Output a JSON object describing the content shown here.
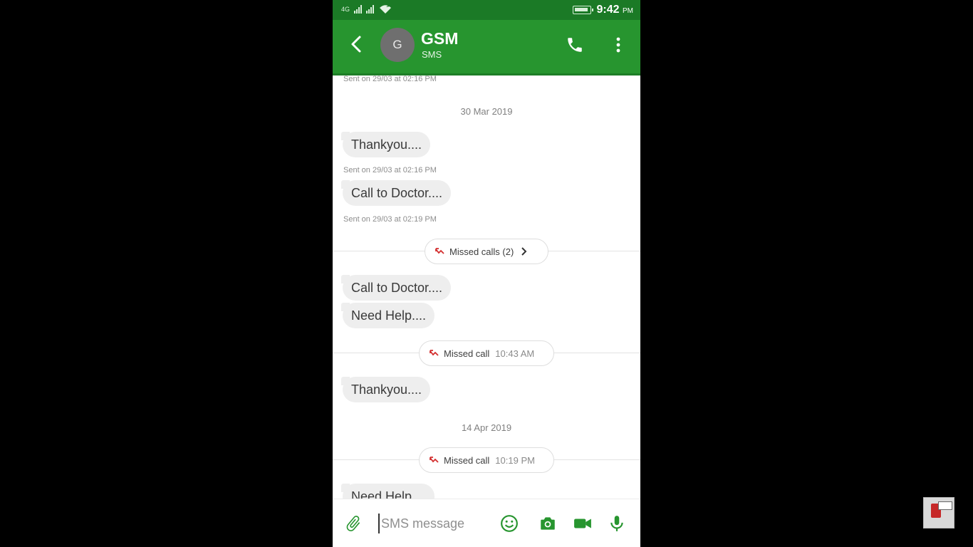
{
  "status_bar": {
    "network_label": "4G",
    "time": "9:42",
    "ampm": "PM"
  },
  "header": {
    "avatar_initial": "G",
    "contact_name": "GSM",
    "subtitle": "SMS"
  },
  "conversation": {
    "sent_info_top": "Sent on 29/03 at 02:16 PM",
    "date_1": "30 Mar 2019",
    "msg_1": "Thankyou....",
    "sent_info_1": "Sent on 29/03 at 02:16 PM",
    "msg_2": "Call to Doctor....",
    "sent_info_2": "Sent on 29/03 at 02:19 PM",
    "missed_calls_label": "Missed calls (2)",
    "msg_3": "Call to Doctor....",
    "msg_4": "Need Help....",
    "missed_call_1_label": "Missed call",
    "missed_call_1_time": "10:43 AM",
    "msg_5": "Thankyou....",
    "date_2": "14 Apr 2019",
    "missed_call_2_label": "Missed call",
    "missed_call_2_time": "10:19 PM",
    "msg_6": "Need Help...."
  },
  "composer": {
    "placeholder": "SMS message"
  },
  "colors": {
    "app_bar": "#27952f",
    "status_bar": "#1b7a26",
    "bubble": "#eeeeee",
    "accent_icons": "#27952f",
    "missed_call": "#d32f2f"
  },
  "icons": [
    "back-arrow-icon",
    "phone-icon",
    "more-vert-icon",
    "missed-call-icon",
    "chevron-right-icon",
    "attach-icon",
    "emoji-icon",
    "camera-icon",
    "video-icon",
    "mic-icon"
  ]
}
